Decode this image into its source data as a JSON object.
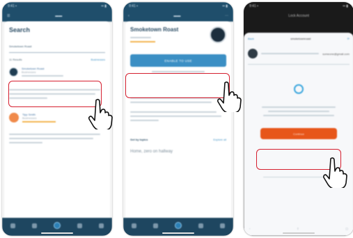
{
  "screens": {
    "search": {
      "title": "Search",
      "query": "Smoketown Roast",
      "results_label": "11 Results",
      "filter_label": "Businesses",
      "result1": {
        "name": "Smoketown Roast",
        "meta": "Businesses"
      },
      "result2": {
        "name": "Tipp Smith",
        "meta": "Businesses"
      }
    },
    "profile": {
      "title": "Smoketown Roast",
      "cta_label": "ENABLE TO USE",
      "section_label": "Get by topics",
      "section_link": "Explore all",
      "big_text": "Home, zero on hallway"
    },
    "auth": {
      "header": "Lock Account",
      "back": "Back",
      "account": "smoketownroast",
      "email": "someone@gmail.com",
      "action_label": "Continue"
    }
  },
  "colors": {
    "brand": "#1f4e6b",
    "primary_button": "#3b8fc4",
    "action_button": "#e7561a",
    "highlight": "#d51f2f"
  },
  "icons": {
    "hand": "pointer-hand-icon",
    "shield": "shield-icon"
  }
}
